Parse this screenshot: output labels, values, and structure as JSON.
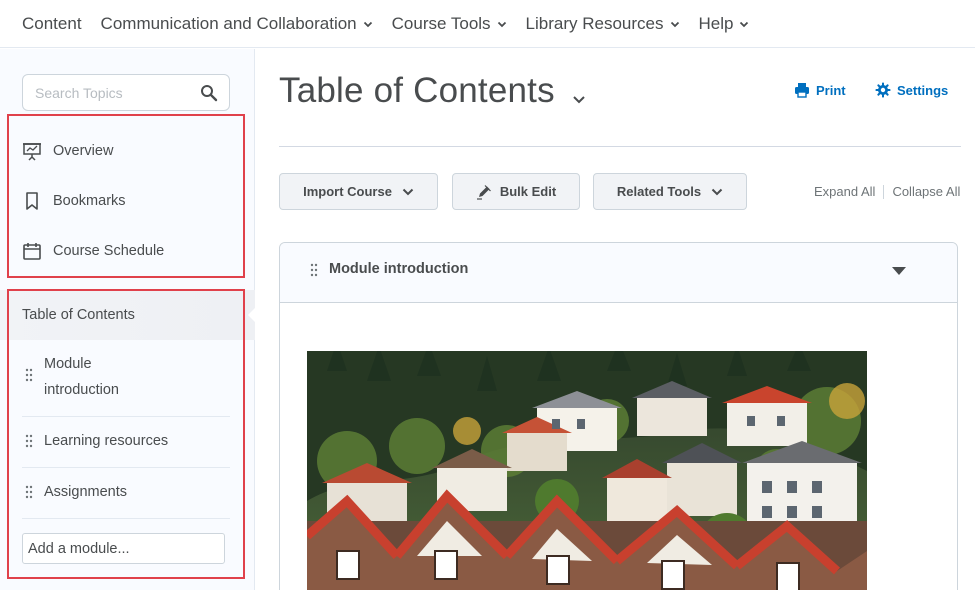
{
  "topnav": {
    "items": [
      {
        "label": "Content",
        "dropdown": false
      },
      {
        "label": "Communication and Collaboration",
        "dropdown": true
      },
      {
        "label": "Course Tools",
        "dropdown": true
      },
      {
        "label": "Library Resources",
        "dropdown": true
      },
      {
        "label": "Help",
        "dropdown": true
      }
    ]
  },
  "sidebar": {
    "search_placeholder": "Search Topics",
    "links": [
      {
        "label": "Overview",
        "icon": "presentation-icon"
      },
      {
        "label": "Bookmarks",
        "icon": "bookmark-icon"
      },
      {
        "label": "Course Schedule",
        "icon": "calendar-icon"
      }
    ],
    "toc_label": "Table of Contents",
    "modules": [
      {
        "label_line1": "Module",
        "label_line2": "introduction"
      },
      {
        "label_line1": "Learning resources"
      },
      {
        "label_line1": "Assignments"
      }
    ],
    "add_module_label": "Add a module..."
  },
  "main": {
    "title": "Table of Contents",
    "print_label": "Print",
    "settings_label": "Settings",
    "buttons": {
      "import_course": "Import Course",
      "bulk_edit": "Bulk Edit",
      "related_tools": "Related Tools"
    },
    "expand_all": "Expand All",
    "collapse_all": "Collapse All",
    "module_card": {
      "title": "Module introduction"
    }
  },
  "colors": {
    "accent": "#006fbf",
    "highlight_box": "#e0414b",
    "text": "#494c4e"
  }
}
